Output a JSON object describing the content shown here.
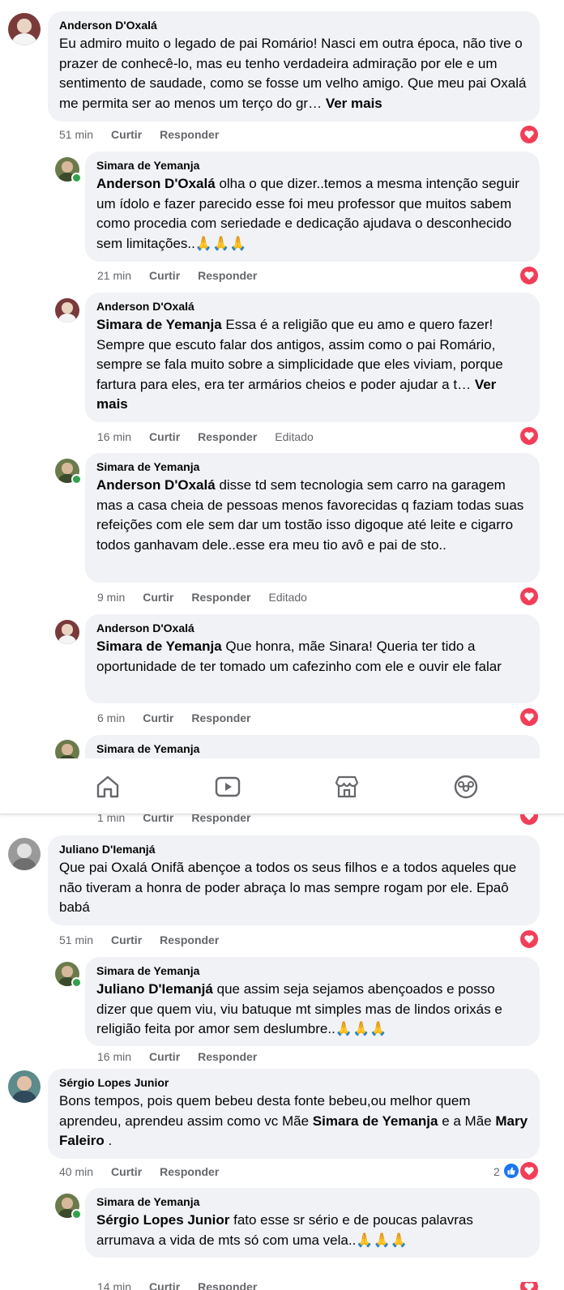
{
  "colors": {
    "bubble": "#f0f2f5",
    "heart": "#f33e58",
    "like": "#1877f2",
    "meta": "#65676b",
    "online": "#31a24c"
  },
  "actions": {
    "like": "Curtir",
    "reply": "Responder",
    "edited": "Editado",
    "see_more": "Ver mais"
  },
  "comments": [
    {
      "author": "Anderson D'Oxalá",
      "text": "Eu admiro muito o legado de pai Romário! Nasci em outra época, não tive o prazer de conhecê-lo, mas eu tenho verdadeira admiração por ele e um sentimento de saudade, como se fosse um velho amigo. Que meu pai Oxalá me permita ser ao menos um terço do gr…",
      "time": "51 min"
    },
    {
      "author": "Simara de Yemanja",
      "mention": "Anderson D'Oxalá",
      "text": "olha o que dizer..temos a mesma intenção seguir um ídolo e fazer parecido esse foi meu professor que muitos sabem como procedia com seriedade e dedicação ajudava o desconhecido sem limitações..🙏🙏🙏",
      "time": "21 min"
    },
    {
      "author": "Anderson D'Oxalá",
      "mention": "Simara de Yemanja",
      "text": "Essa é a religião que eu amo e quero fazer! Sempre que escuto falar dos antigos, assim como o pai Romário, sempre se fala muito sobre a simplicidade que eles viviam, porque fartura para eles, era ter armários cheios e poder ajudar a t…",
      "time": "16 min"
    },
    {
      "author": "Simara de Yemanja",
      "mention": "Anderson D'Oxalá",
      "text": "disse td sem tecnologia sem carro na garagem mas a casa cheia de pessoas menos favorecidas q faziam todas suas refeições com ele sem dar um tostão isso digoque até leite e cigarro todos ganhavam dele..esse era meu tio avô e pai de sto..",
      "time": "9 min"
    },
    {
      "author": "Anderson D'Oxalá",
      "mention": "Simara de Yemanja",
      "text": "Que honra, mãe Sinara! Queria ter tido a oportunidade de ter tomado um cafezinho com ele e ouvir ele falar",
      "time": "6 min"
    },
    {
      "author": "Simara de Yemanja",
      "time": "1 min"
    },
    {
      "author": "Juliano D'Iemanjá",
      "text": "Que pai Oxalá Onifã abençoe a todos os seus filhos e a todos aqueles que não tiveram a honra de poder abraça lo mas sempre rogam por ele. Epaô babá",
      "time": "51 min"
    },
    {
      "author": "Simara de Yemanja",
      "mention": "Juliano D'Iemanjá",
      "text": "que assim seja sejamos abençoados e posso dizer que quem viu, viu batuque mt simples mas de lindos orixás e religião feita por amor sem deslumbre..🙏🙏🙏",
      "time": "16 min"
    },
    {
      "author": "Sérgio Lopes Junior",
      "text_before": "Bons tempos, pois quem bebeu desta fonte bebeu,ou melhor quem aprendeu, aprendeu assim como vc Mãe ",
      "mention_1": "Simara de Yemanja",
      "text_middle": " e a Mãe ",
      "mention_2": "Mary Faleiro",
      "text_after": " .",
      "time": "40 min",
      "reactions": "2"
    },
    {
      "author": "Simara de Yemanja",
      "mention": "Sérgio Lopes Junior",
      "text": "fato esse sr sério e de poucas palavras arrumava a vida de mts só com uma vela..🙏🙏🙏",
      "time": "14 min"
    }
  ],
  "nav": {
    "items": [
      "home-icon",
      "video-icon",
      "marketplace-icon",
      "groups-icon"
    ]
  }
}
